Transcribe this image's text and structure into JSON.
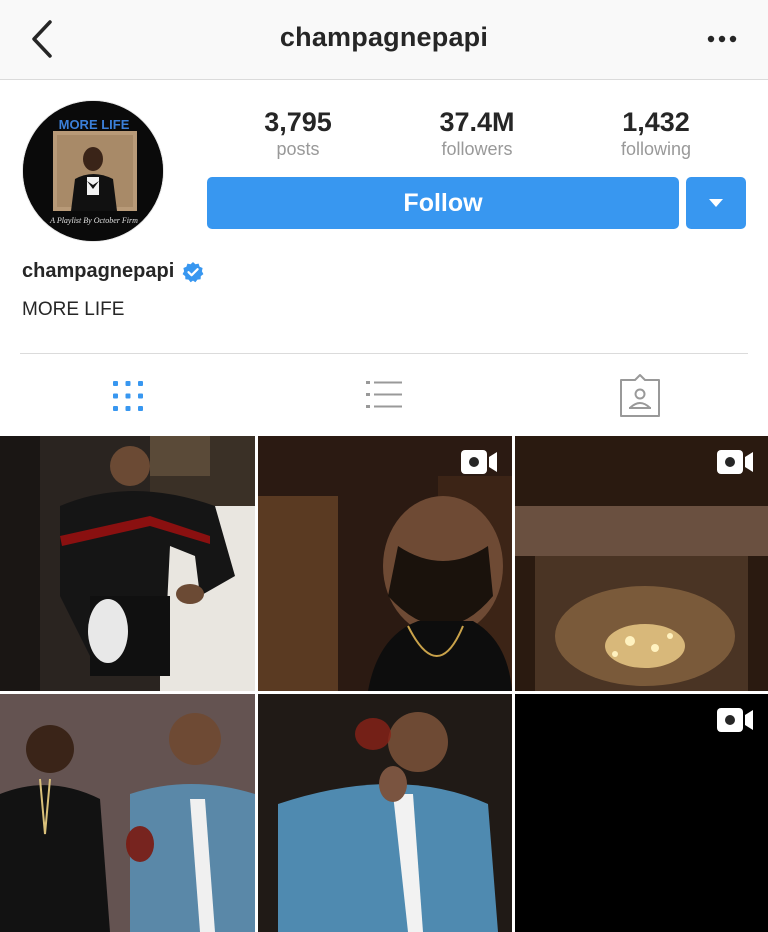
{
  "header": {
    "username": "champagnepapi",
    "back_icon": "chevron-left-icon",
    "more_icon": "more-horizontal-icon"
  },
  "profile": {
    "avatar_text_top": "MORE LIFE",
    "avatar_text_bottom": "A Playlist By October Firm",
    "name": "champagnepapi",
    "verified": true,
    "bio": "MORE LIFE"
  },
  "stats": [
    {
      "value": "3,795",
      "label": "posts"
    },
    {
      "value": "37.4M",
      "label": "followers"
    },
    {
      "value": "1,432",
      "label": "following"
    }
  ],
  "actions": {
    "follow_label": "Follow",
    "dropdown_icon": "caret-down-icon"
  },
  "tabs": [
    {
      "name": "grid",
      "icon": "grid-icon",
      "active": true
    },
    {
      "name": "list",
      "icon": "list-icon",
      "active": false
    },
    {
      "name": "tagged",
      "icon": "tagged-photos-icon",
      "active": false
    }
  ],
  "posts": [
    {
      "type": "photo"
    },
    {
      "type": "video"
    },
    {
      "type": "video"
    },
    {
      "type": "photo"
    },
    {
      "type": "photo"
    },
    {
      "type": "video"
    }
  ],
  "colors": {
    "accent": "#3897f0",
    "active_tab": "#3897f0",
    "inactive_tab": "#999999"
  }
}
